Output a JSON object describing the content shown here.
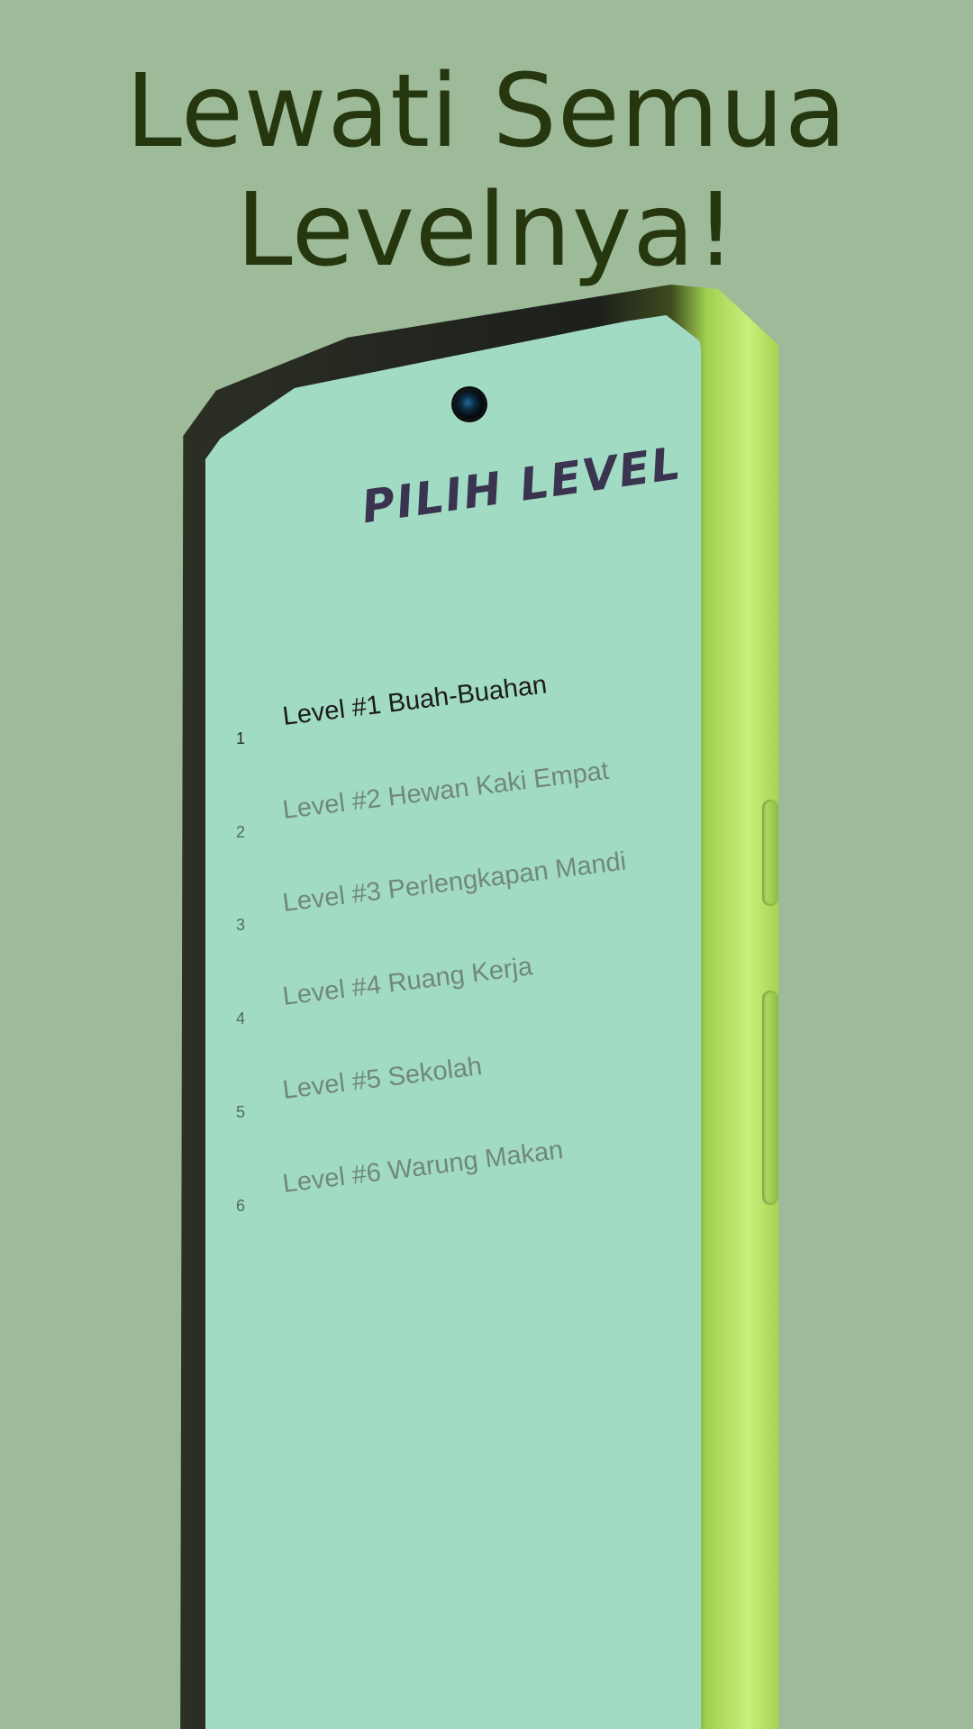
{
  "promo": {
    "headline_line1": "Lewati Semua",
    "headline_line2": "Levelnya!"
  },
  "screen": {
    "title": "Pilih Level",
    "levels": [
      {
        "number": "1",
        "label": "Level #1 Buah-Buahan",
        "state": "unlocked"
      },
      {
        "number": "2",
        "label": "Level #2 Hewan Kaki Empat",
        "state": "locked"
      },
      {
        "number": "3",
        "label": "Level #3 Perlengkapan Mandi",
        "state": "locked"
      },
      {
        "number": "4",
        "label": "Level #4 Ruang Kerja",
        "state": "locked"
      },
      {
        "number": "5",
        "label": "Level #5 Sekolah",
        "state": "locked"
      },
      {
        "number": "6",
        "label": "Level #6 Warung Makan",
        "state": "locked"
      }
    ]
  },
  "colors": {
    "background": "#9dbb98",
    "headline": "#263710",
    "screen": "#a2dbc4",
    "title": "#3a3450",
    "active_text": "#1b1b1b",
    "locked_text": "#70887c",
    "phone_accent": "#c8f07c"
  },
  "icons": {
    "camera": "front-camera-icon"
  }
}
